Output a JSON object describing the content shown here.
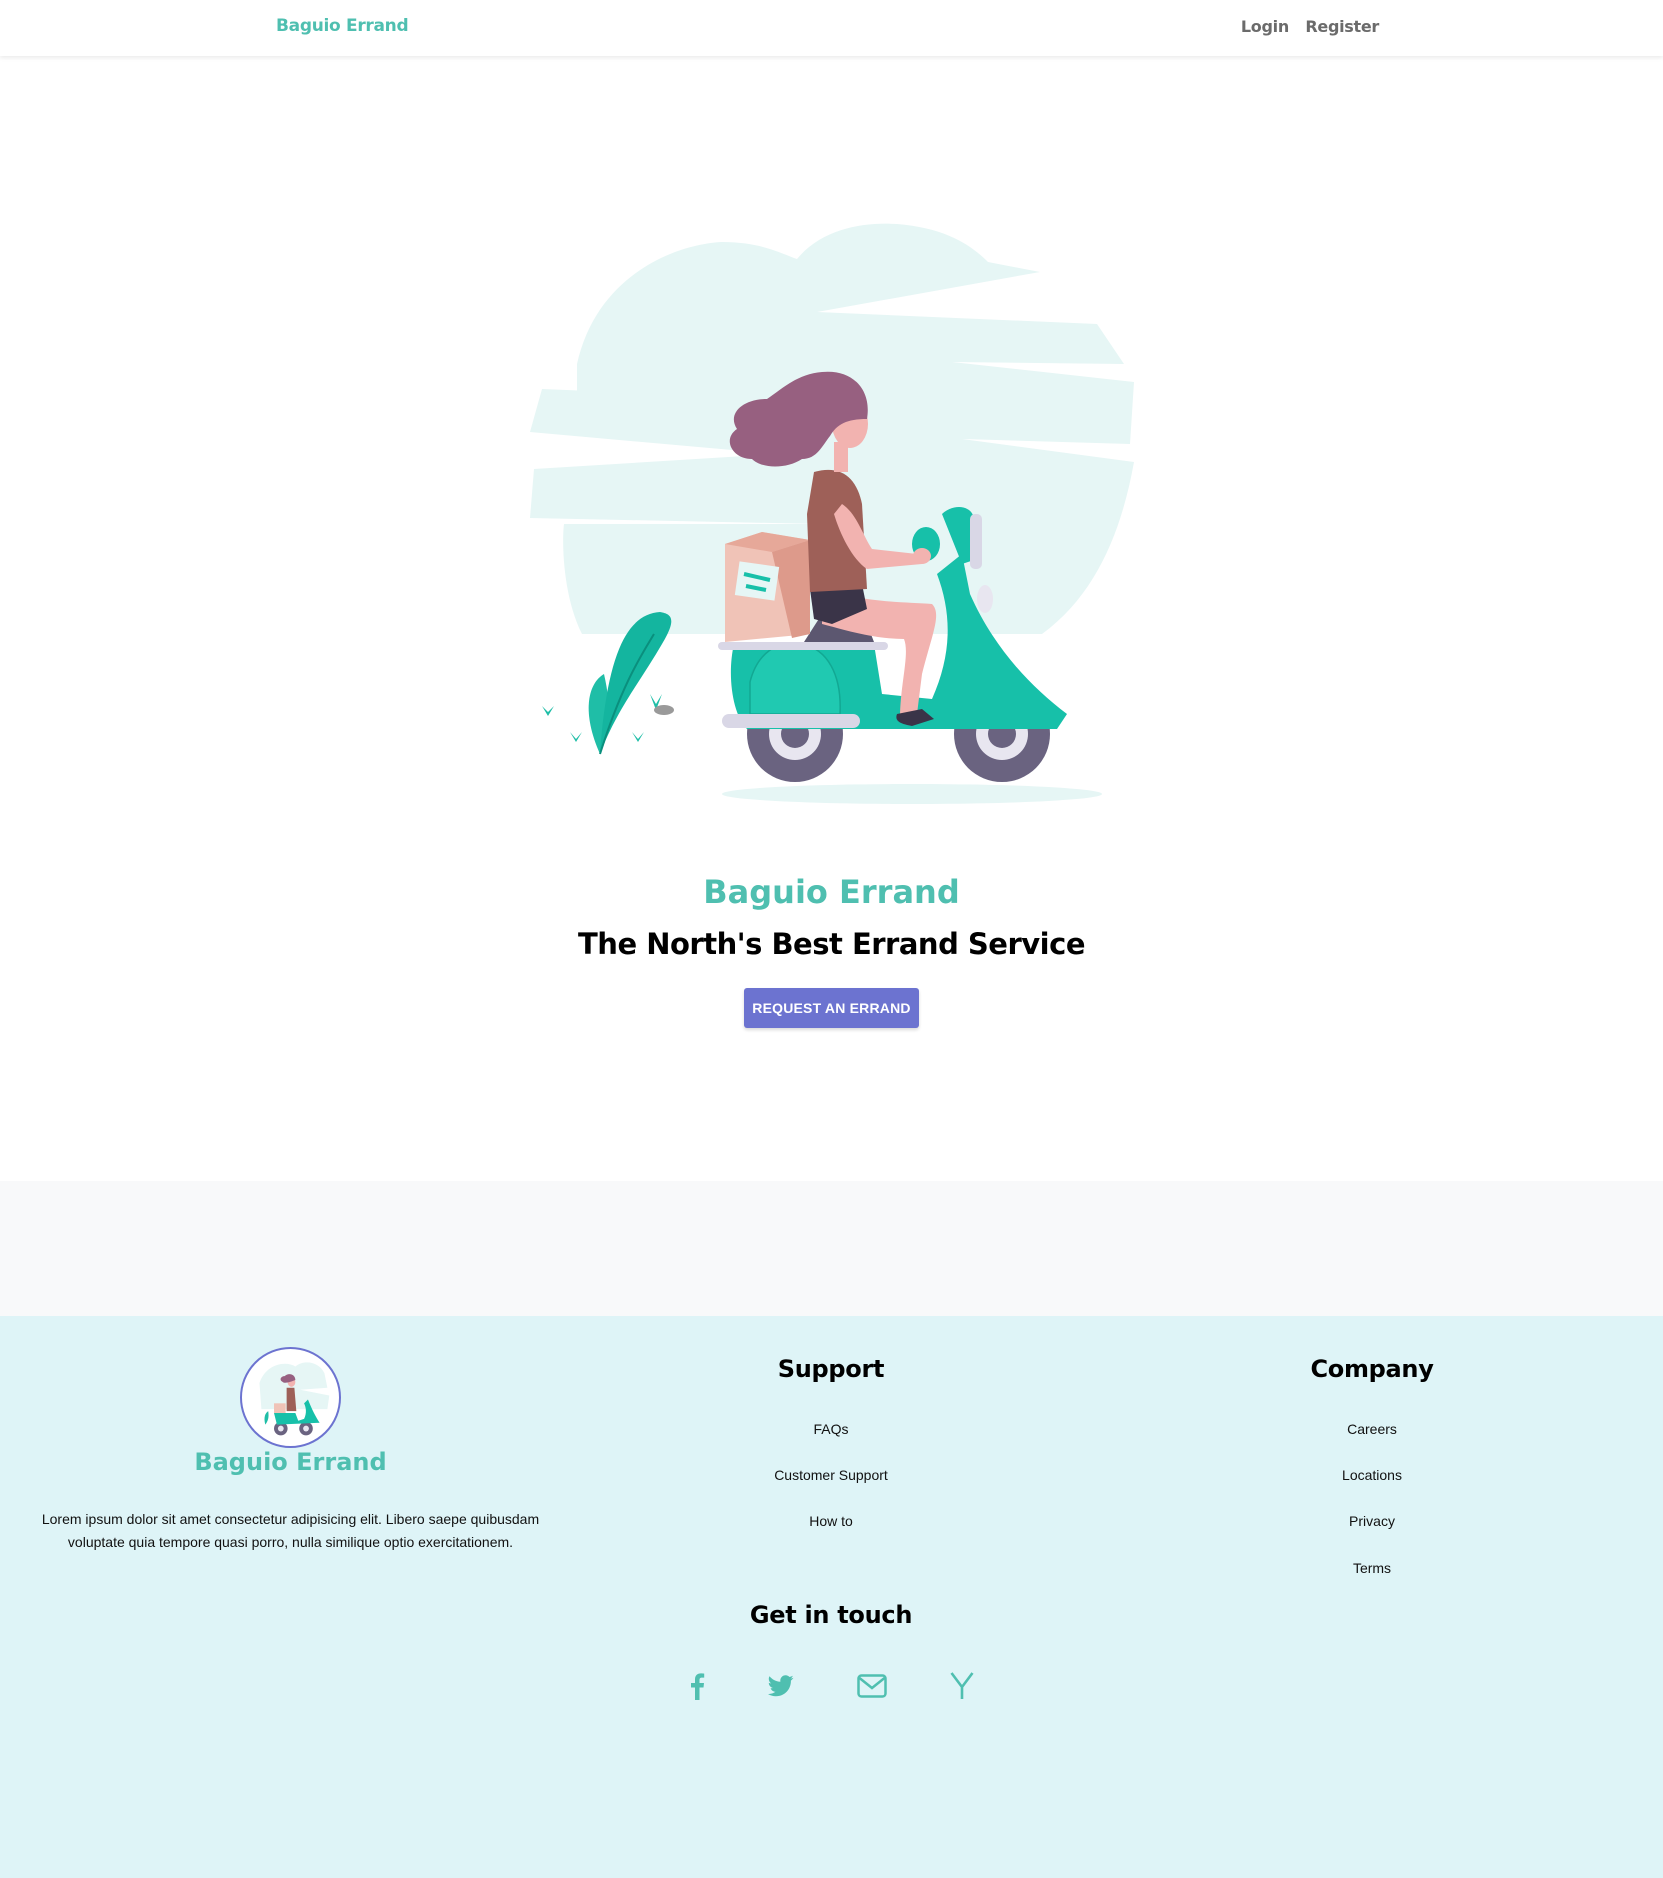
{
  "nav": {
    "brand": "Baguio Errand",
    "login": "Login",
    "register": "Register"
  },
  "hero": {
    "title": "Baguio Errand",
    "subtitle": "The North's Best Errand Service",
    "cta": "REQUEST AN ERRAND"
  },
  "footer": {
    "brand": "Baguio Errand",
    "description": "Lorem ipsum dolor sit amet consectetur adipisicing elit. Libero saepe quibusdam voluptate quia tempore quasi porro, nulla similique optio exercitationem.",
    "support": {
      "title": "Support",
      "links": [
        "FAQs",
        "Customer Support",
        "How to"
      ]
    },
    "company": {
      "title": "Company",
      "links": [
        "Careers",
        "Locations",
        "Privacy",
        "Terms"
      ]
    },
    "get_in_touch": {
      "title": "Get in touch",
      "icons": [
        "facebook-icon",
        "twitter-icon",
        "envelope-icon",
        "y-combinator-icon"
      ]
    }
  },
  "colors": {
    "brand": "#4fbfb0",
    "button": "#6c73d0",
    "footer_bg": "#def4f7",
    "band_bg": "#f8f9fa"
  }
}
